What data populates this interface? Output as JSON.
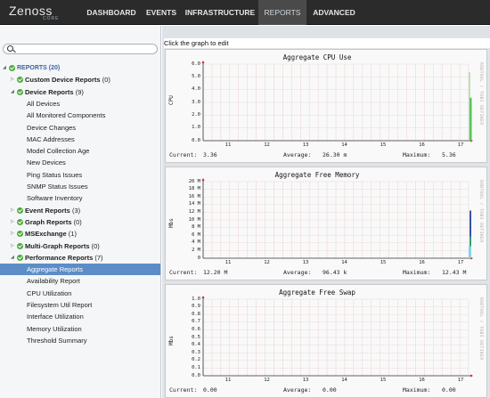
{
  "app": {
    "logo_text": "Zenoss",
    "logo_sub": "CORE"
  },
  "nav": {
    "dashboard": "DASHBOARD",
    "events": "EVENTS",
    "infrastructure": "INFRASTRUCTURE",
    "reports": "REPORTS",
    "advanced": "ADVANCED"
  },
  "sidebar": {
    "search_placeholder": "",
    "tree": [
      {
        "label": "REPORTS (20)",
        "level": 0,
        "kind": "root"
      },
      {
        "label": "Custom Device Reports",
        "count": "(0)",
        "level": 1,
        "kind": "folder",
        "expanded": false
      },
      {
        "label": "Device Reports",
        "count": "(9)",
        "level": 1,
        "kind": "folder",
        "expanded": true
      },
      {
        "label": "All Devices",
        "level": 2,
        "kind": "leaf"
      },
      {
        "label": "All Monitored Components",
        "level": 2,
        "kind": "leaf"
      },
      {
        "label": "Device Changes",
        "level": 2,
        "kind": "leaf"
      },
      {
        "label": "MAC Addresses",
        "level": 2,
        "kind": "leaf"
      },
      {
        "label": "Model Collection Age",
        "level": 2,
        "kind": "leaf"
      },
      {
        "label": "New Devices",
        "level": 2,
        "kind": "leaf"
      },
      {
        "label": "Ping Status Issues",
        "level": 2,
        "kind": "leaf"
      },
      {
        "label": "SNMP Status Issues",
        "level": 2,
        "kind": "leaf"
      },
      {
        "label": "Software Inventory",
        "level": 2,
        "kind": "leaf"
      },
      {
        "label": "Event Reports",
        "count": "(3)",
        "level": 1,
        "kind": "folder",
        "expanded": false
      },
      {
        "label": "Graph Reports",
        "count": "(0)",
        "level": 1,
        "kind": "folder",
        "expanded": false
      },
      {
        "label": "MSExchange",
        "count": "(1)",
        "level": 1,
        "kind": "folder",
        "expanded": false
      },
      {
        "label": "Multi-Graph Reports",
        "count": "(0)",
        "level": 1,
        "kind": "folder",
        "expanded": false
      },
      {
        "label": "Performance Reports",
        "count": "(7)",
        "level": 1,
        "kind": "folder",
        "expanded": true
      },
      {
        "label": "Aggregate Reports",
        "level": 2,
        "kind": "leaf",
        "selected": true
      },
      {
        "label": "Availability Report",
        "level": 2,
        "kind": "leaf"
      },
      {
        "label": "CPU Utilization",
        "level": 2,
        "kind": "leaf"
      },
      {
        "label": "Filesystem Util Report",
        "level": 2,
        "kind": "leaf"
      },
      {
        "label": "Interface Utilization",
        "level": 2,
        "kind": "leaf"
      },
      {
        "label": "Memory Utilization",
        "level": 2,
        "kind": "leaf"
      },
      {
        "label": "Threshold Summary",
        "level": 2,
        "kind": "leaf"
      }
    ]
  },
  "main": {
    "hint": "Click the graph to edit",
    "side_text": "RRDTOOL / TOBI OETIKER",
    "graphs": [
      {
        "title": "Aggregate CPU Use",
        "ylabel": "CPU",
        "yticks": [
          "6.0",
          "5.0",
          "4.0",
          "3.0",
          "2.0",
          "1.0",
          "0.0"
        ],
        "xticks": [
          "11",
          "12",
          "13",
          "14",
          "15",
          "16",
          "17"
        ],
        "stats": {
          "current_label": "Current:",
          "current": "3.36",
          "average_label": "Average:",
          "average": "26.30 m",
          "maximum_label": "Maximum:",
          "maximum": "5.36"
        }
      },
      {
        "title": "Aggregate Free Memory",
        "ylabel": "Mbs",
        "yticks": [
          "20 M",
          "18 M",
          "16 M",
          "14 M",
          "12 M",
          "10 M",
          "8 M",
          "6 M",
          "4 M",
          "2 M",
          "0"
        ],
        "xticks": [
          "11",
          "12",
          "13",
          "14",
          "15",
          "16",
          "17"
        ],
        "stats": {
          "current_label": "Current:",
          "current": "12.20 M",
          "average_label": "Average:",
          "average": "96.43 k",
          "maximum_label": "Maximum:",
          "maximum": "12.43 M"
        }
      },
      {
        "title": "Aggregate Free Swap",
        "ylabel": "Mbs",
        "yticks": [
          "1.0",
          "0.9",
          "0.8",
          "0.7",
          "0.6",
          "0.5",
          "0.4",
          "0.3",
          "0.2",
          "0.1",
          "0.0"
        ],
        "xticks": [
          "11",
          "12",
          "13",
          "14",
          "15",
          "16",
          "17"
        ],
        "stats": {
          "current_label": "Current:",
          "current": "0.00",
          "average_label": "Average:",
          "average": "0.00",
          "maximum_label": "Maximum:",
          "maximum": "0.00"
        }
      }
    ]
  },
  "chart_data": [
    {
      "type": "area",
      "title": "Aggregate CPU Use",
      "ylabel": "CPU",
      "xlabel": "",
      "ylim": [
        0,
        6
      ],
      "x": [
        "11",
        "12",
        "13",
        "14",
        "15",
        "16",
        "17"
      ],
      "series": [
        {
          "values_at_end": {
            "x": "17",
            "peak": 5.36,
            "current": 3.36
          },
          "color": "#55c155"
        }
      ],
      "grid": true
    },
    {
      "type": "area",
      "title": "Aggregate Free Memory",
      "ylabel": "Mbs",
      "xlabel": "",
      "ylim": [
        0,
        20
      ],
      "x": [
        "11",
        "12",
        "13",
        "14",
        "15",
        "16",
        "17"
      ],
      "series": [
        {
          "values_at_end": {
            "x": "17",
            "peak": 12.43,
            "current": 12.2
          },
          "colors": [
            "#3b4fb0",
            "#2aa36b",
            "#7fd7ea"
          ]
        }
      ],
      "grid": true
    },
    {
      "type": "line",
      "title": "Aggregate Free Swap",
      "ylabel": "Mbs",
      "xlabel": "",
      "ylim": [
        0,
        1
      ],
      "x": [
        "11",
        "12",
        "13",
        "14",
        "15",
        "16",
        "17"
      ],
      "series": [],
      "grid": true
    }
  ]
}
